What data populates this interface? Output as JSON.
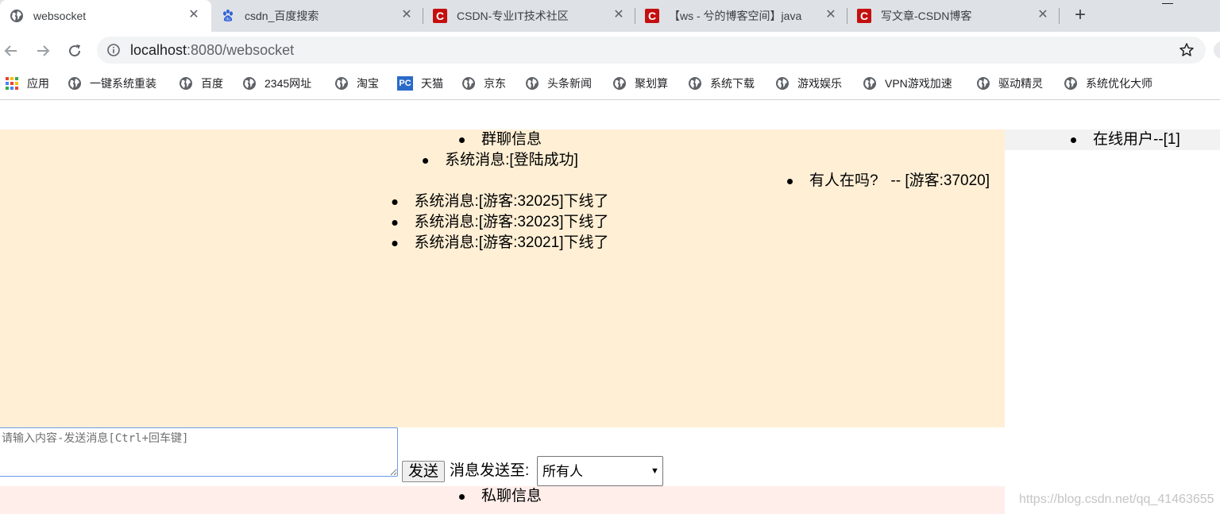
{
  "browser": {
    "tabs": [
      {
        "title": "websocket",
        "favicon": "globe-icon",
        "active": true
      },
      {
        "title": "csdn_百度搜索",
        "favicon": "baidu-paw-icon",
        "active": false
      },
      {
        "title": "CSDN-专业IT技术社区",
        "favicon": "csdn-icon",
        "active": false
      },
      {
        "title": "【ws - 兮的博客空间】java",
        "favicon": "csdn-icon",
        "active": false
      },
      {
        "title": "写文章-CSDN博客",
        "favicon": "csdn-icon",
        "active": false
      }
    ],
    "csdn_favicon_letter": "C",
    "tab_close_glyph": "✕",
    "new_tab_glyph": "+",
    "address": {
      "host": "localhost",
      "path": ":8080/websocket"
    },
    "bookmarks": [
      {
        "label": "应用",
        "icon": "apps-grid-icon"
      },
      {
        "label": "一键系统重装",
        "icon": "globe-icon"
      },
      {
        "label": "百度",
        "icon": "globe-icon"
      },
      {
        "label": "2345网址",
        "icon": "globe-icon"
      },
      {
        "label": "淘宝",
        "icon": "globe-icon"
      },
      {
        "label": "天猫",
        "icon": "tmall-icon"
      },
      {
        "label": "京东",
        "icon": "globe-icon"
      },
      {
        "label": "头条新闻",
        "icon": "globe-icon"
      },
      {
        "label": "聚划算",
        "icon": "globe-icon"
      },
      {
        "label": "系统下载",
        "icon": "globe-icon"
      },
      {
        "label": "游戏娱乐",
        "icon": "globe-icon"
      },
      {
        "label": "VPN游戏加速",
        "icon": "globe-icon"
      },
      {
        "label": "驱动精灵",
        "icon": "globe-icon"
      },
      {
        "label": "系统优化大师",
        "icon": "globe-icon"
      }
    ],
    "tmall_icon_text": "PC"
  },
  "chat": {
    "group_title": "群聊信息",
    "group_messages": [
      {
        "text": "系统消息:[登陆成功]",
        "align": "center"
      },
      {
        "text": "有人在吗?   -- [游客:37020]",
        "align": "right"
      },
      {
        "text": "系统消息:[游客:32025]下线了",
        "align": "center"
      },
      {
        "text": "系统消息:[游客:32023]下线了",
        "align": "center"
      },
      {
        "text": "系统消息:[游客:32021]下线了",
        "align": "center"
      }
    ],
    "online_users_label": "在线用户--[1]",
    "input_placeholder": "请输入内容-发送消息[Ctrl+回车键]",
    "send_label": "发送",
    "send_to_label": "消息发送至:",
    "recipient_selected": "所有人",
    "private_title": "私聊信息"
  },
  "watermark": "https://blog.csdn.net/qq_41463655",
  "colors": {
    "group_panel": "#ffefd5",
    "private_panel": "#ffeeea",
    "users_panel": "#f2f2f2",
    "csdn_red": "#c40f0f"
  }
}
